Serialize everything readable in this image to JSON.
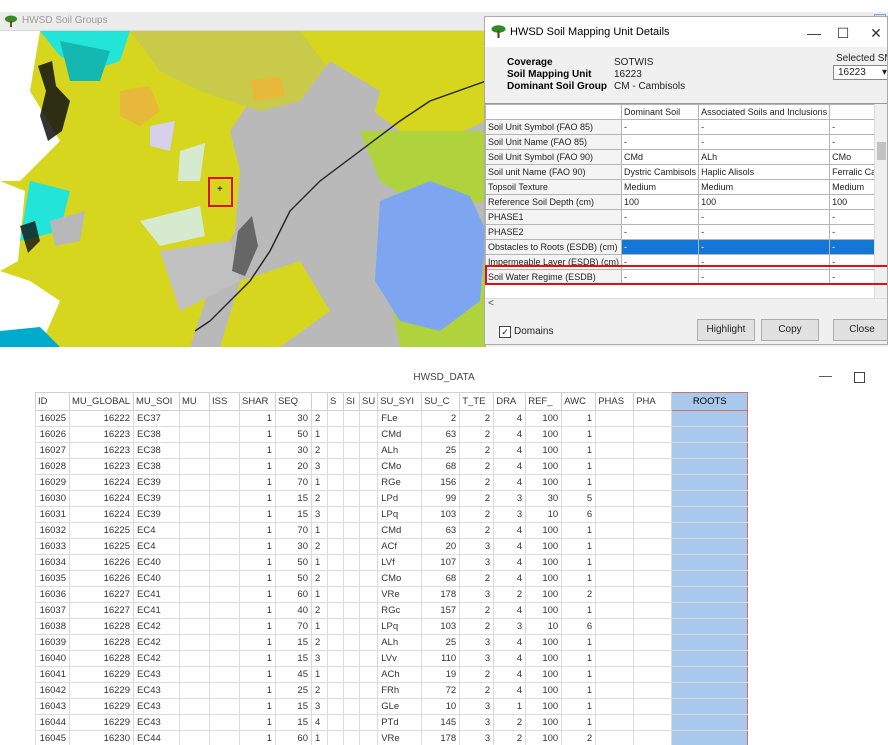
{
  "map_window": {
    "title": "HWSD Soil Groups"
  },
  "map_marker": "+",
  "dialog": {
    "title": "HWSD Soil Mapping Unit Details",
    "info": [
      {
        "key": "Coverage",
        "value": "SOTWIS"
      },
      {
        "key": "Soil Mapping Unit",
        "value": "16223"
      },
      {
        "key": "Dominant Soil Group",
        "value": "CM - Cambisols"
      }
    ],
    "selected_label": "Selected SMU",
    "selected_value": "16223",
    "columns": [
      "",
      "Dominant Soil",
      "Associated Soils and Inclusions",
      ""
    ],
    "rows": [
      {
        "label": "Soil Unit Symbol (FAO 85)",
        "v1": "-",
        "v2": "-",
        "v3": "-"
      },
      {
        "label": "Soil Unit Name (FAO 85)",
        "v1": "-",
        "v2": "-",
        "v3": "-"
      },
      {
        "label": "Soil Unit Symbol (FAO 90)",
        "v1": "CMd",
        "v2": "ALh",
        "v3": "CMo"
      },
      {
        "label": "Soil unit Name (FAO 90)",
        "v1": "Dystric Cambisols",
        "v2": "Haplic Alisols",
        "v3": "Ferralic Cambi"
      },
      {
        "label": "Topsoil Texture",
        "v1": "Medium",
        "v2": "Medium",
        "v3": "Medium"
      },
      {
        "label": "Reference Soil Depth (cm)",
        "v1": "100",
        "v2": "100",
        "v3": "100"
      },
      {
        "label": "PHASE1",
        "v1": "-",
        "v2": "-",
        "v3": "-"
      },
      {
        "label": "PHASE2",
        "v1": "-",
        "v2": "-",
        "v3": "-"
      },
      {
        "label": "Obstacles to Roots (ESDB) (cm)",
        "v1": "-",
        "v2": "-",
        "v3": "-",
        "highlight": true
      },
      {
        "label": "Impermeable Layer  (ESDB) (cm)",
        "v1": "-",
        "v2": "-",
        "v3": "-"
      },
      {
        "label": "Soil Water Regime  (ESDB)",
        "v1": "-",
        "v2": "-",
        "v3": "-"
      }
    ],
    "domains_label": "Domains",
    "buttons": {
      "highlight": "Highlight",
      "copy": "Copy",
      "close": "Close"
    }
  },
  "data_window": {
    "title": "HWSD_DATA",
    "columns": [
      "ID",
      "MU_GLOBAL",
      "MU_SOI",
      "MU",
      "ISS",
      "SHAR",
      "SEQ",
      "",
      "S",
      "SI",
      "SU",
      "SU_SYI",
      "SU_C",
      "T_TE",
      "DRA",
      "REF_",
      "AWC",
      "PHAS",
      "PHA",
      "ROOTS"
    ],
    "rows": [
      [
        "16025",
        "16222",
        "EC37",
        "",
        "",
        "1",
        "30",
        "2",
        "",
        "",
        "",
        "FLe",
        "2",
        "2",
        "4",
        "100",
        "1",
        "",
        "",
        ""
      ],
      [
        "16026",
        "16223",
        "EC38",
        "",
        "",
        "1",
        "50",
        "1",
        "",
        "",
        "",
        "CMd",
        "63",
        "2",
        "4",
        "100",
        "1",
        "",
        "",
        ""
      ],
      [
        "16027",
        "16223",
        "EC38",
        "",
        "",
        "1",
        "30",
        "2",
        "",
        "",
        "",
        "ALh",
        "25",
        "2",
        "4",
        "100",
        "1",
        "",
        "",
        ""
      ],
      [
        "16028",
        "16223",
        "EC38",
        "",
        "",
        "1",
        "20",
        "3",
        "",
        "",
        "",
        "CMo",
        "68",
        "2",
        "4",
        "100",
        "1",
        "",
        "",
        ""
      ],
      [
        "16029",
        "16224",
        "EC39",
        "",
        "",
        "1",
        "70",
        "1",
        "",
        "",
        "",
        "RGe",
        "156",
        "2",
        "4",
        "100",
        "1",
        "",
        "",
        ""
      ],
      [
        "16030",
        "16224",
        "EC39",
        "",
        "",
        "1",
        "15",
        "2",
        "",
        "",
        "",
        "LPd",
        "99",
        "2",
        "3",
        "30",
        "5",
        "",
        "",
        ""
      ],
      [
        "16031",
        "16224",
        "EC39",
        "",
        "",
        "1",
        "15",
        "3",
        "",
        "",
        "",
        "LPq",
        "103",
        "2",
        "3",
        "10",
        "6",
        "",
        "",
        ""
      ],
      [
        "16032",
        "16225",
        "EC4",
        "",
        "",
        "1",
        "70",
        "1",
        "",
        "",
        "",
        "CMd",
        "63",
        "2",
        "4",
        "100",
        "1",
        "",
        "",
        ""
      ],
      [
        "16033",
        "16225",
        "EC4",
        "",
        "",
        "1",
        "30",
        "2",
        "",
        "",
        "",
        "ACf",
        "20",
        "3",
        "4",
        "100",
        "1",
        "",
        "",
        ""
      ],
      [
        "16034",
        "16226",
        "EC40",
        "",
        "",
        "1",
        "50",
        "1",
        "",
        "",
        "",
        "LVf",
        "107",
        "3",
        "4",
        "100",
        "1",
        "",
        "",
        ""
      ],
      [
        "16035",
        "16226",
        "EC40",
        "",
        "",
        "1",
        "50",
        "2",
        "",
        "",
        "",
        "CMo",
        "68",
        "2",
        "4",
        "100",
        "1",
        "",
        "",
        ""
      ],
      [
        "16036",
        "16227",
        "EC41",
        "",
        "",
        "1",
        "60",
        "1",
        "",
        "",
        "",
        "VRe",
        "178",
        "3",
        "2",
        "100",
        "2",
        "",
        "",
        ""
      ],
      [
        "16037",
        "16227",
        "EC41",
        "",
        "",
        "1",
        "40",
        "2",
        "",
        "",
        "",
        "RGc",
        "157",
        "2",
        "4",
        "100",
        "1",
        "",
        "",
        ""
      ],
      [
        "16038",
        "16228",
        "EC42",
        "",
        "",
        "1",
        "70",
        "1",
        "",
        "",
        "",
        "LPq",
        "103",
        "2",
        "3",
        "10",
        "6",
        "",
        "",
        ""
      ],
      [
        "16039",
        "16228",
        "EC42",
        "",
        "",
        "1",
        "15",
        "2",
        "",
        "",
        "",
        "ALh",
        "25",
        "3",
        "4",
        "100",
        "1",
        "",
        "",
        ""
      ],
      [
        "16040",
        "16228",
        "EC42",
        "",
        "",
        "1",
        "15",
        "3",
        "",
        "",
        "",
        "LVv",
        "110",
        "3",
        "4",
        "100",
        "1",
        "",
        "",
        ""
      ],
      [
        "16041",
        "16229",
        "EC43",
        "",
        "",
        "1",
        "45",
        "1",
        "",
        "",
        "",
        "ACh",
        "19",
        "2",
        "4",
        "100",
        "1",
        "",
        "",
        ""
      ],
      [
        "16042",
        "16229",
        "EC43",
        "",
        "",
        "1",
        "25",
        "2",
        "",
        "",
        "",
        "FRh",
        "72",
        "2",
        "4",
        "100",
        "1",
        "",
        "",
        ""
      ],
      [
        "16043",
        "16229",
        "EC43",
        "",
        "",
        "1",
        "15",
        "3",
        "",
        "",
        "",
        "GLe",
        "10",
        "3",
        "1",
        "100",
        "1",
        "",
        "",
        ""
      ],
      [
        "16044",
        "16229",
        "EC43",
        "",
        "",
        "1",
        "15",
        "4",
        "",
        "",
        "",
        "PTd",
        "145",
        "3",
        "2",
        "100",
        "1",
        "",
        "",
        ""
      ],
      [
        "16045",
        "16230",
        "EC44",
        "",
        "",
        "1",
        "60",
        "1",
        "",
        "",
        "",
        "VRe",
        "178",
        "3",
        "2",
        "100",
        "2",
        "",
        "",
        ""
      ]
    ]
  },
  "colors": {
    "highlight": "#1477d8",
    "roots_column": "#a9c9ec",
    "annotation_red": "#e01010"
  }
}
